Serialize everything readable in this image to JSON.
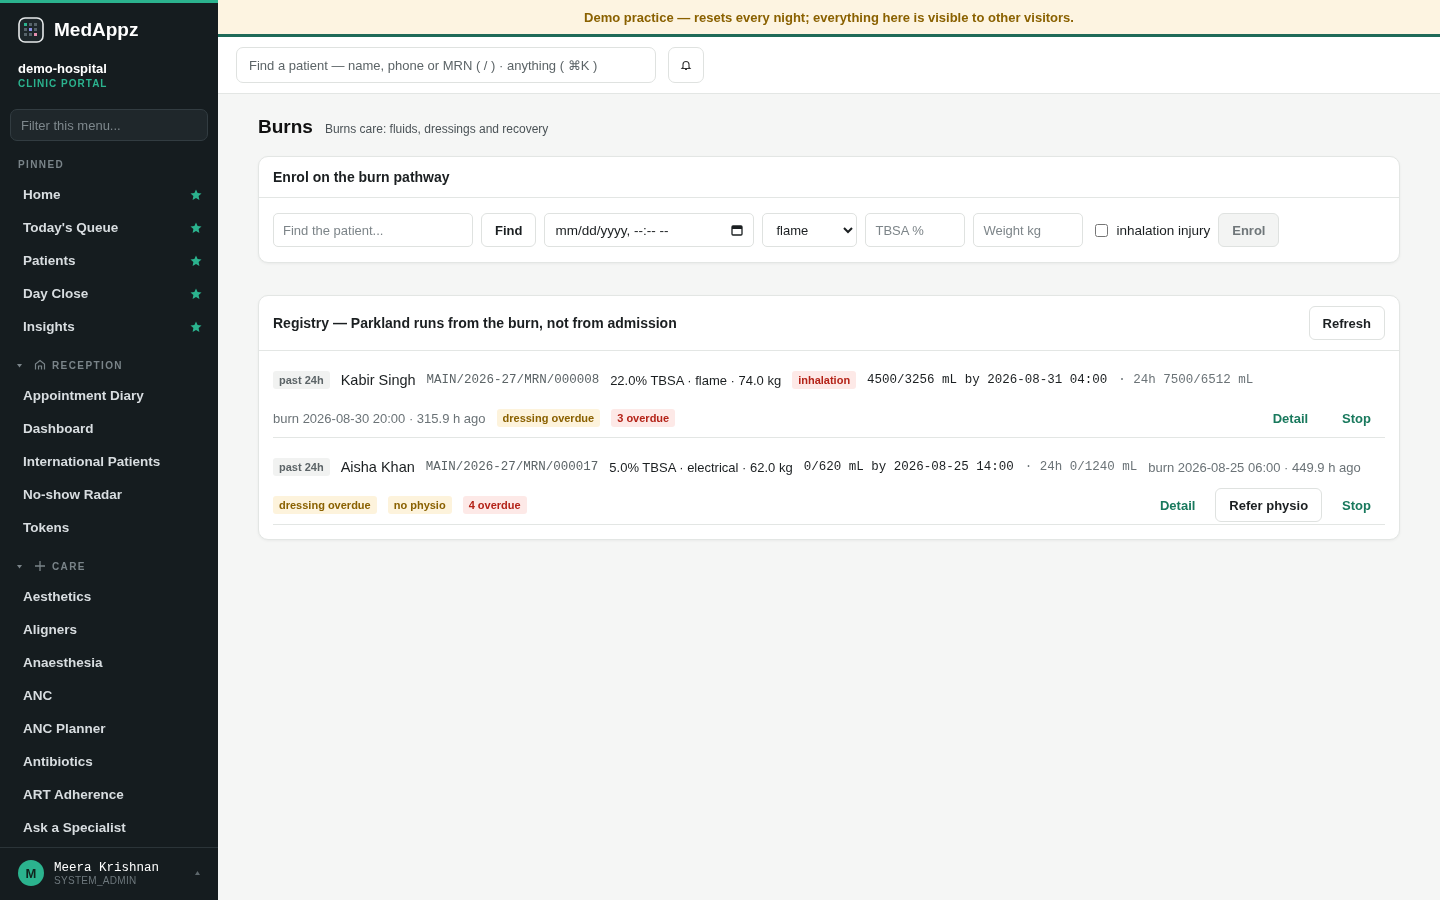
{
  "brand": {
    "name": "MedAppz",
    "org": "demo-hospital",
    "portal": "CLINIC PORTAL"
  },
  "sidebar": {
    "filter_placeholder": "Filter this menu...",
    "sections": [
      {
        "title": "PINNED",
        "kind": "pinned",
        "items": [
          {
            "label": "Home",
            "pinned": true
          },
          {
            "label": "Today's Queue",
            "pinned": true
          },
          {
            "label": "Patients",
            "pinned": true
          },
          {
            "label": "Day Close",
            "pinned": true
          },
          {
            "label": "Insights",
            "pinned": true
          }
        ]
      },
      {
        "title": "RECEPTION",
        "kind": "reception",
        "expanded": true,
        "items": [
          {
            "label": "Appointment Diary",
            "pinned": false
          },
          {
            "label": "Dashboard",
            "pinned": false
          },
          {
            "label": "International Patients",
            "pinned": false
          },
          {
            "label": "No-show Radar",
            "pinned": false
          },
          {
            "label": "Tokens",
            "pinned": false
          }
        ]
      },
      {
        "title": "CARE",
        "kind": "care",
        "expanded": true,
        "items": [
          {
            "label": "Aesthetics",
            "pinned": false
          },
          {
            "label": "Aligners",
            "pinned": false
          },
          {
            "label": "Anaesthesia",
            "pinned": false
          },
          {
            "label": "ANC",
            "pinned": false
          },
          {
            "label": "ANC Planner",
            "pinned": false
          },
          {
            "label": "Antibiotics",
            "pinned": false
          },
          {
            "label": "ART Adherence",
            "pinned": false
          },
          {
            "label": "Ask a Specialist",
            "pinned": false
          }
        ]
      }
    ],
    "user": {
      "initial": "M",
      "name": "Meera Krishnan",
      "role": "SYSTEM_ADMIN"
    }
  },
  "banner": "Demo practice — resets every night; everything here is visible to other visitors.",
  "topbar": {
    "search_placeholder": "Find a patient — name, phone or MRN ( / ) · anything ( ⌘K )"
  },
  "page": {
    "title": "Burns",
    "subtitle": "Burns care: fluids, dressings and recovery"
  },
  "enrol": {
    "title": "Enrol on the burn pathway",
    "patient_placeholder": "Find the patient...",
    "find": "Find",
    "datetime": "mm/dd/yyyy, --:-- --",
    "mechanism": "flame",
    "tbsa_placeholder": "TBSA %",
    "weight_placeholder": "Weight kg",
    "inhalation": {
      "label": "inhalation injury",
      "checked": false
    },
    "submit": {
      "label": "Enrol",
      "disabled": true
    }
  },
  "registry": {
    "title": "Registry — Parkland runs from the burn, not from admission",
    "refresh": "Refresh",
    "rows": [
      {
        "window": "past 24h",
        "name": "Kabir Singh",
        "mrn": "MAIN/2026-27/MRN/000008",
        "summary": "22.0% TBSA · flame · 74.0 kg",
        "flags": [
          {
            "label": "inhalation",
            "kind": "danger"
          }
        ],
        "fluid": "4500/3256 mL by 2026-08-31 04:00",
        "fluid_24h": "· 24h 7500/6512 mL",
        "burn": "burn 2026-08-30 20:00 · 315.9 h ago",
        "tags": [
          {
            "label": "dressing overdue",
            "kind": "warn"
          },
          {
            "label": "3 overdue",
            "kind": "danger"
          }
        ],
        "actions": [
          {
            "label": "Detail",
            "kind": "link"
          },
          {
            "label": "Stop",
            "kind": "link"
          }
        ]
      },
      {
        "window": "past 24h",
        "name": "Aisha Khan",
        "mrn": "MAIN/2026-27/MRN/000017",
        "summary": "5.0% TBSA · electrical · 62.0 kg",
        "flags": [],
        "fluid": "0/620 mL by 2026-08-25 14:00",
        "fluid_24h": "· 24h 0/1240 mL",
        "burn": "burn 2026-08-25 06:00 · 449.9 h ago",
        "tags": [
          {
            "label": "dressing overdue",
            "kind": "warn"
          },
          {
            "label": "no physio",
            "kind": "warn"
          },
          {
            "label": "4 overdue",
            "kind": "danger"
          }
        ],
        "actions": [
          {
            "label": "Detail",
            "kind": "link"
          },
          {
            "label": "Refer physio",
            "kind": "button"
          },
          {
            "label": "Stop",
            "kind": "link"
          }
        ]
      }
    ]
  }
}
